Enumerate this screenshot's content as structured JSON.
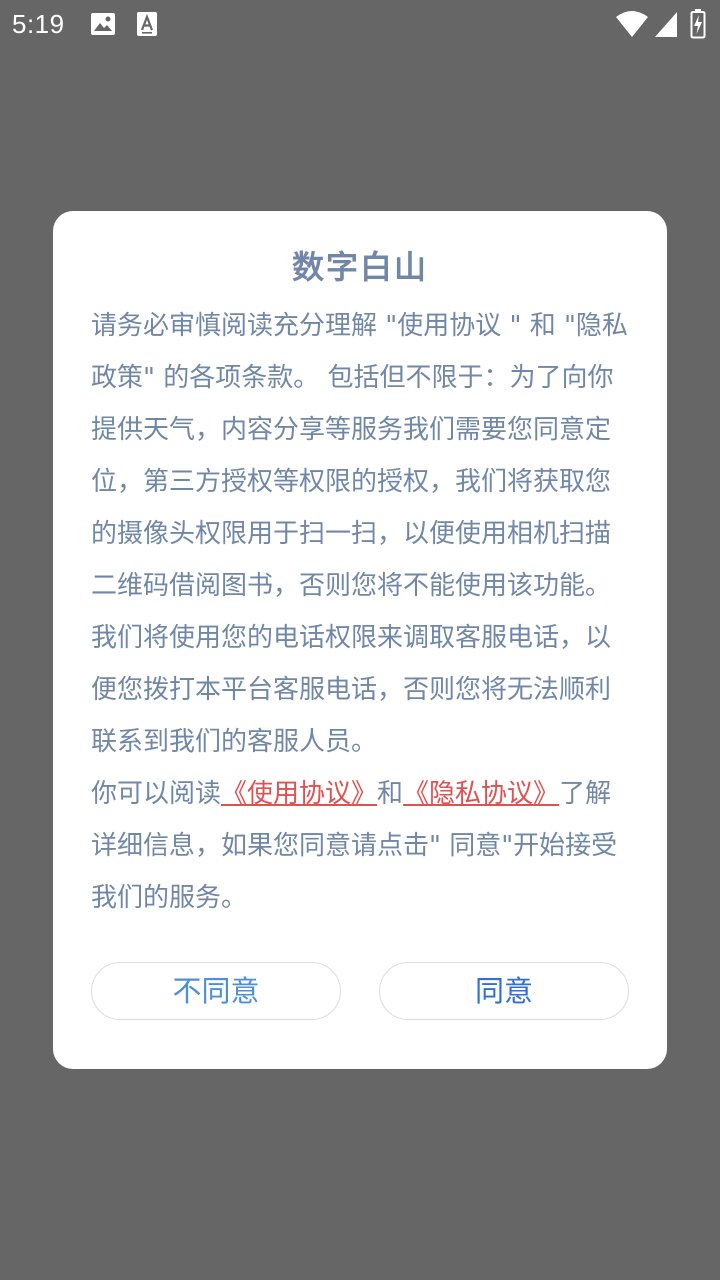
{
  "status_bar": {
    "time": "5:19",
    "icons": [
      "image-icon",
      "text-a-icon",
      "wifi-icon",
      "cell-signal-icon",
      "battery-charging-icon"
    ]
  },
  "dialog": {
    "title": "数字白山",
    "paragraph1": "请务必审慎阅读充分理解 \"使用协议 \" 和 \"隐私政策\" 的各项条款。 包括但不限于：为了向你提供天气，内容分享等服务我们需要您同意定位，第三方授权等权限的授权，我们将获取您的摄像头权限用于扫一扫，以便使用相机扫描二维码借阅图书，否则您将不能使用该功能。我们将使用您的电话权限来调取客服电话，以便您拨打本平台客服电话，否则您将无法顺利联系到我们的客服人员。",
    "paragraph2": {
      "prefix": "你可以阅读",
      "link_terms": "《使用协议》",
      "conjunction": "和",
      "link_privacy": "《隐私协议》",
      "suffix": "了解详细信息，如果您同意请点击\" 同意\"开始接受我们的服务。"
    },
    "disagree_label": "不同意",
    "agree_label": "同意"
  },
  "colors": {
    "overlay": "#666666",
    "dialog_text": "#7187a8",
    "link": "#e05151",
    "button_text": "#2e6fd9"
  }
}
